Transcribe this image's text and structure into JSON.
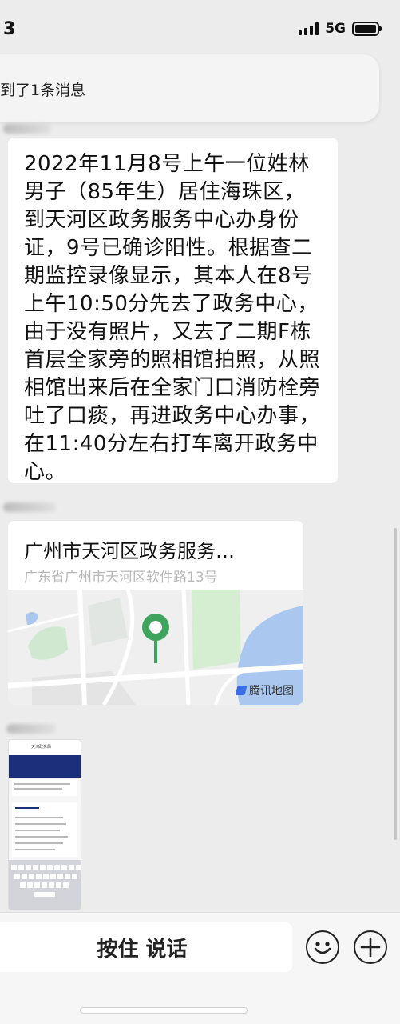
{
  "status_bar": {
    "time": "3",
    "network": "5G",
    "icons": [
      "signal-bars-icon",
      "battery-icon"
    ]
  },
  "notification": {
    "text": "到了1条消息"
  },
  "chat": {
    "message_text": "2022年11月8号上午一位姓林男子（85年生）居住海珠区，到天河区政务服务中心办身份证，9号已确诊阳性。根据查二期监控录像显示，其本人在8号上午10:50分先去了政务中心，由于没有照片，又去了二期F栋首层全家旁的照相馆拍照，从照相馆出来后在全家门口消防栓旁吐了口痰，再进政务中心办事，在11:40分左右打车离开政务中心。",
    "location": {
      "title": "广州市天河区政务服务…",
      "address": "广东省广州市天河区软件路13号",
      "map_provider": "腾讯地图",
      "pin_color": "#3ea35c"
    },
    "screenshot_thumb": {
      "title": "天河政务局",
      "icon": "phone-screenshot-icon"
    }
  },
  "input_bar": {
    "voice_label": "按住 说话",
    "icons": [
      "emoji-icon",
      "plus-icon"
    ]
  },
  "colors": {
    "background": "#ececec",
    "bubble": "#ffffff",
    "accent_green": "#3ea35c"
  }
}
